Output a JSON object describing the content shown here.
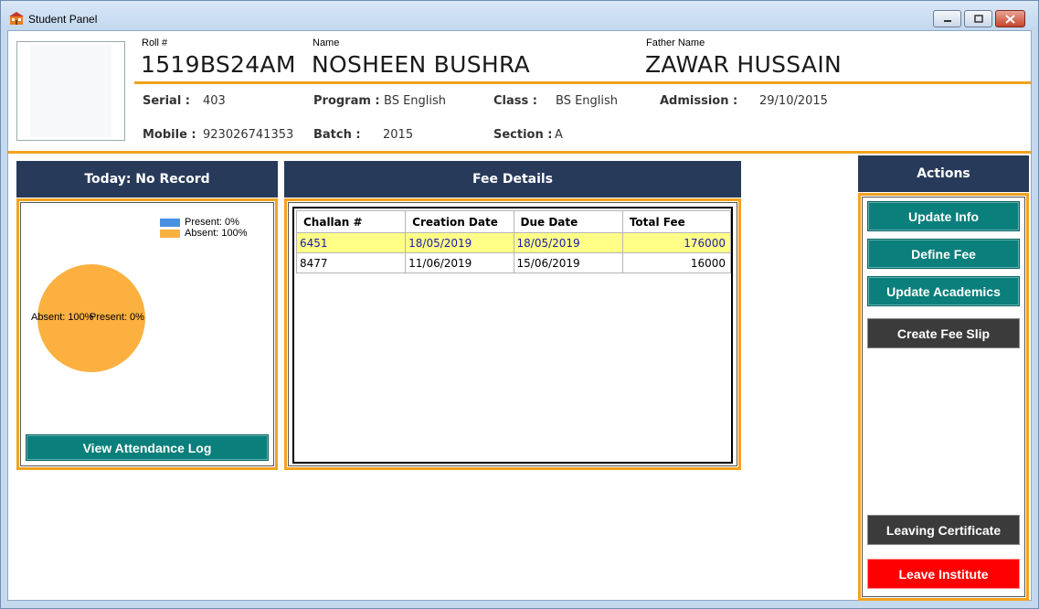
{
  "window": {
    "title": "Student Panel"
  },
  "student": {
    "roll_label": "Roll #",
    "roll": "1519BS24AM",
    "name_label": "Name",
    "name": "NOSHEEN BUSHRA",
    "father_label": "Father Name",
    "father": "ZAWAR HUSSAIN",
    "serial_label": "Serial :",
    "serial": "403",
    "program_label": "Program :",
    "program": "BS English",
    "class_label": "Class :",
    "class": "BS English",
    "admission_label": "Admission :",
    "admission": "29/10/2015",
    "mobile_label": "Mobile :",
    "mobile": "923026741353",
    "batch_label": "Batch :",
    "batch": "2015",
    "section_label": "Section :",
    "section": "A"
  },
  "attendance": {
    "header": "Today: No Record",
    "legend": [
      {
        "label": "Present: 0%",
        "color": "#4a90e2"
      },
      {
        "label": "Absent: 100%",
        "color": "#fbb040"
      }
    ],
    "pie_labels": {
      "absent": "Absent: 100%",
      "present": "Present: 0%"
    },
    "chart_data": {
      "type": "pie",
      "slices": [
        {
          "name": "Present",
          "value": 0,
          "color": "#4a90e2"
        },
        {
          "name": "Absent",
          "value": 100,
          "color": "#fbb040"
        }
      ]
    },
    "button": "View Attendance Log"
  },
  "fees": {
    "header": "Fee Details",
    "columns": [
      "Challan #",
      "Creation Date",
      "Due Date",
      "Total Fee"
    ],
    "rows": [
      [
        "6451",
        "18/05/2019",
        "18/05/2019",
        "176000"
      ],
      [
        "8477",
        "11/06/2019",
        "15/06/2019",
        "16000"
      ]
    ]
  },
  "actions": {
    "header": "Actions",
    "update_info": "Update Info",
    "define_fee": "Define Fee",
    "update_academics": "Update Academics",
    "create_fee_slip": "Create Fee Slip",
    "leaving_certificate": "Leaving Certificate",
    "leave_institute": "Leave Institute"
  }
}
